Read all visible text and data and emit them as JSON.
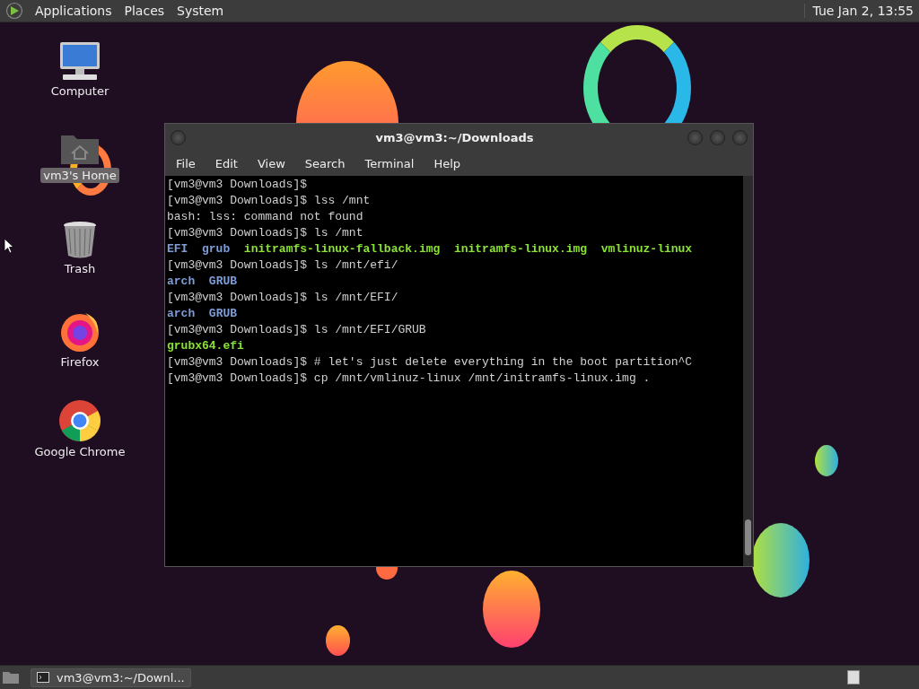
{
  "top_panel": {
    "menus": [
      "Applications",
      "Places",
      "System"
    ],
    "clock": "Tue Jan  2, 13:55"
  },
  "desktop_icons": [
    {
      "kind": "computer",
      "label": "Computer",
      "selected": false
    },
    {
      "kind": "home",
      "label": "vm3's Home",
      "selected": true
    },
    {
      "kind": "trash",
      "label": "Trash",
      "selected": false
    },
    {
      "kind": "firefox",
      "label": "Firefox",
      "selected": false
    },
    {
      "kind": "chrome",
      "label": "Google Chrome",
      "selected": false
    }
  ],
  "terminal_window": {
    "title": "vm3@vm3:~/Downloads",
    "menu": [
      "File",
      "Edit",
      "View",
      "Search",
      "Terminal",
      "Help"
    ],
    "lines": [
      [
        {
          "kind": "plain",
          "text": "[vm3@vm3 Downloads]$"
        }
      ],
      [
        {
          "kind": "plain",
          "text": "[vm3@vm3 Downloads]$ lss /mnt"
        }
      ],
      [
        {
          "kind": "plain",
          "text": "bash: lss: command not found"
        }
      ],
      [
        {
          "kind": "plain",
          "text": "[vm3@vm3 Downloads]$ ls /mnt"
        }
      ],
      [
        {
          "kind": "dir",
          "text": "EFI"
        },
        {
          "kind": "dir",
          "text": "grub"
        },
        {
          "kind": "exec",
          "text": "initramfs-linux-fallback.img"
        },
        {
          "kind": "exec",
          "text": "initramfs-linux.img"
        },
        {
          "kind": "exec",
          "text": "vmlinuz-linux"
        }
      ],
      [
        {
          "kind": "plain",
          "text": "[vm3@vm3 Downloads]$ ls /mnt/efi/"
        }
      ],
      [
        {
          "kind": "dir",
          "text": "arch"
        },
        {
          "kind": "dir",
          "text": "GRUB"
        }
      ],
      [
        {
          "kind": "plain",
          "text": "[vm3@vm3 Downloads]$ ls /mnt/EFI/"
        }
      ],
      [
        {
          "kind": "dir",
          "text": "arch"
        },
        {
          "kind": "dir",
          "text": "GRUB"
        }
      ],
      [
        {
          "kind": "plain",
          "text": "[vm3@vm3 Downloads]$ ls /mnt/EFI/GRUB"
        }
      ],
      [
        {
          "kind": "exec",
          "text": "grubx64.efi"
        }
      ],
      [
        {
          "kind": "plain",
          "text": "[vm3@vm3 Downloads]$ # let's just delete everything in the boot partition^C"
        }
      ],
      [
        {
          "kind": "plain",
          "text": "[vm3@vm3 Downloads]$ cp /mnt/vmlinuz-linux /mnt/initramfs-linux.img ."
        }
      ]
    ]
  },
  "taskbar": {
    "tasks": [
      {
        "label": "vm3@vm3:~/Downl...",
        "selected": false
      }
    ]
  }
}
